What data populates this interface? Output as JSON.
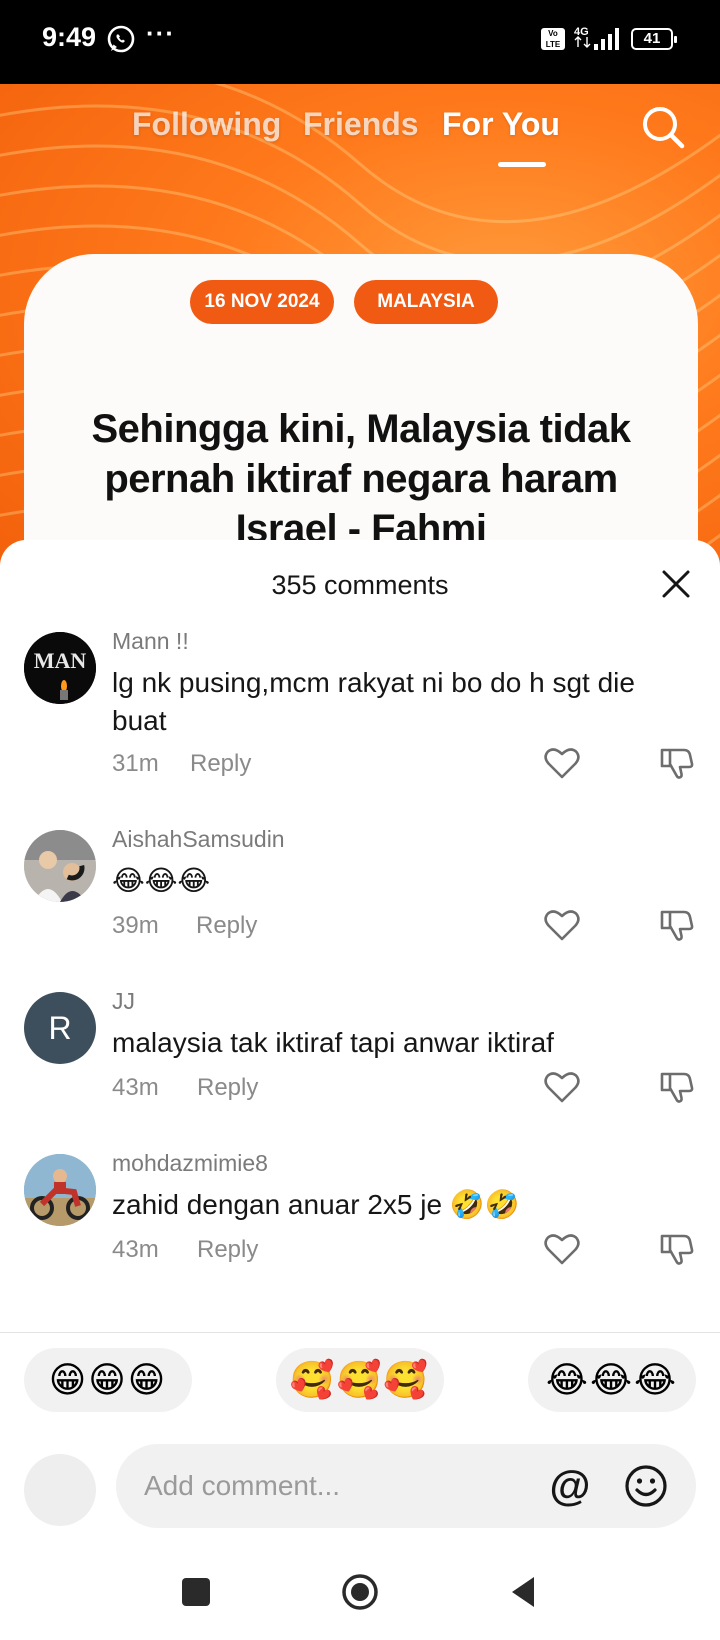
{
  "status_bar": {
    "time": "9:49",
    "dots": "···",
    "volte": "Vo LTE",
    "network": "4G",
    "battery": "41"
  },
  "top_nav": {
    "tabs": [
      {
        "label": "Following"
      },
      {
        "label": "Friends"
      },
      {
        "label": "For You",
        "active": true
      }
    ]
  },
  "video": {
    "tags": [
      "16 NOV 2024",
      "MALAYSIA"
    ],
    "headline": "Sehingga kini, Malaysia tidak pernah iktiraf negara haram Israel - Fahmi"
  },
  "comments_sheet": {
    "title": "355 comments",
    "comments": [
      {
        "user": "Mann !!",
        "text": "lg nk pusing,mcm rakyat ni bo do h sgt die buat",
        "time": "31m",
        "reply": "Reply",
        "avatar_text": "MAN"
      },
      {
        "user": "AishahSamsudin",
        "text": "😂😂😂",
        "time": "39m",
        "reply": "Reply"
      },
      {
        "user": "JJ",
        "text": "malaysia tak iktiraf tapi anwar iktiraf",
        "time": "43m",
        "reply": "Reply",
        "avatar_text": "R"
      },
      {
        "user": "mohdazmimie8",
        "text": "zahid dengan anuar 2x5 je 🤣🤣",
        "time": "43m",
        "reply": "Reply"
      }
    ],
    "quick_emojis": [
      "😁😁😁",
      "🥰🥰🥰",
      "😂😂😂"
    ],
    "composer": {
      "placeholder": "Add comment...",
      "at_symbol": "@"
    }
  },
  "colors": {
    "accent_orange": "#f05a12",
    "background_orange": "#ff7a1c",
    "sheet_bg": "#ffffff",
    "muted_text": "#8a8a8a"
  },
  "icons": [
    "whatsapp-icon",
    "search-icon",
    "close-icon",
    "heart-icon",
    "dislike-icon",
    "smile-icon",
    "square-nav-icon",
    "home-nav-icon",
    "back-nav-icon"
  ]
}
